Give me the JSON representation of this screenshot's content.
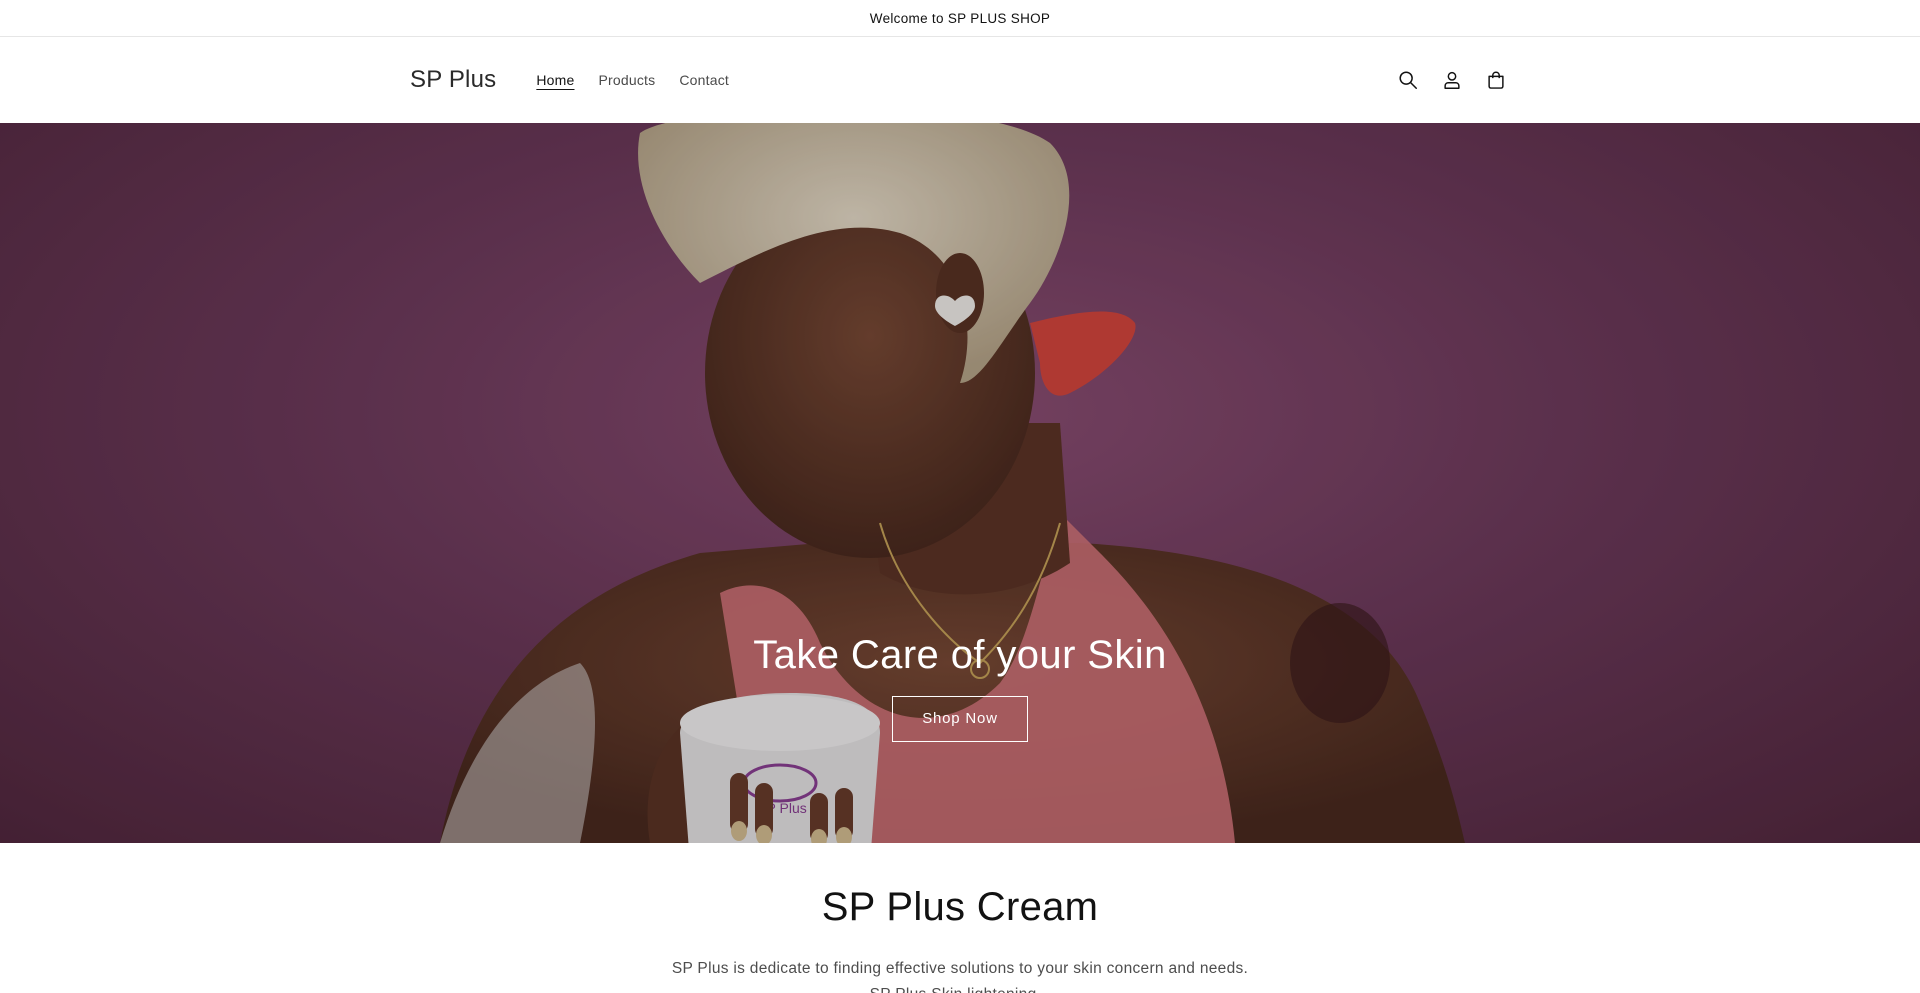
{
  "announcement": {
    "text": "Welcome to SP PLUS SHOP"
  },
  "header": {
    "logo": "SP Plus",
    "nav": [
      {
        "label": "Home",
        "active": true
      },
      {
        "label": "Products",
        "active": false
      },
      {
        "label": "Contact",
        "active": false
      }
    ],
    "icons": [
      "search-icon",
      "account-icon",
      "cart-icon"
    ]
  },
  "hero": {
    "title": "Take Care of your Skin",
    "button_label": "Shop Now",
    "jar_label": "SP Plus",
    "background_color": "#7a4467"
  },
  "intro": {
    "title": "SP Plus Cream",
    "text_line1": "SP Plus is dedicate to finding effective solutions to your skin concern and needs.",
    "text_line2": "SP Plus Skin lightening..."
  }
}
